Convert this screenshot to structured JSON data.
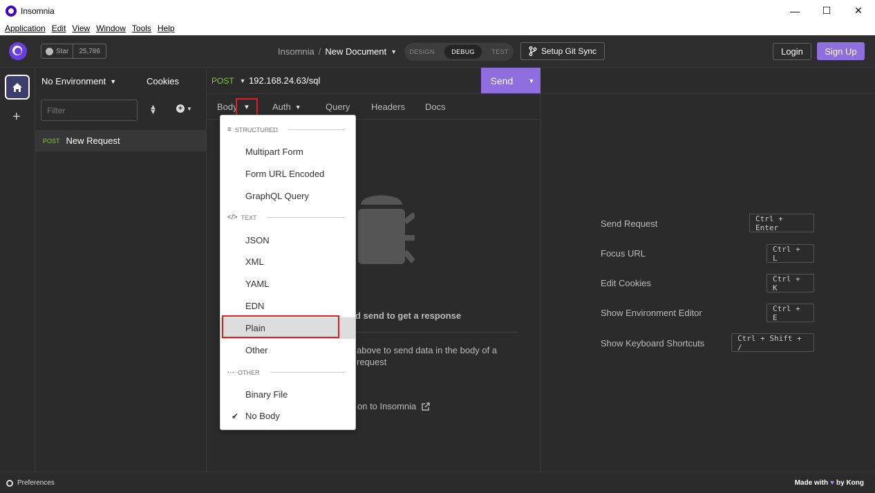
{
  "window": {
    "title": "Insomnia",
    "controls": {
      "minimize": "—",
      "maximize": "☐",
      "close": "✕"
    }
  },
  "menubar": [
    "Application",
    "Edit",
    "View",
    "Window",
    "Tools",
    "Help"
  ],
  "header": {
    "github_star_label": "Star",
    "github_star_count": "25,786",
    "breadcrumb_root": "Insomnia",
    "breadcrumb_sep": "/",
    "breadcrumb_doc": "New Document",
    "modes": [
      "DESIGN",
      "DEBUG",
      "TEST"
    ],
    "active_mode": "DEBUG",
    "git_sync_label": "Setup Git Sync",
    "login_label": "Login",
    "signup_label": "Sign Up"
  },
  "sidebar": {
    "environment": "No Environment",
    "cookies": "Cookies",
    "filter_placeholder": "Filter",
    "requests": [
      {
        "method": "POST",
        "name": "New Request"
      }
    ]
  },
  "request": {
    "method": "POST",
    "url": "192.168.24.63/sql",
    "send_label": "Send",
    "tabs": {
      "body": "Body",
      "auth": "Auth",
      "query": "Query",
      "headers": "Headers",
      "docs": "Docs"
    },
    "empty_state": {
      "line1": "d send to get a response",
      "line2": "above to send data in the body of a request",
      "line3": "on to Insomnia"
    }
  },
  "body_dropdown": {
    "sections": [
      {
        "label": "STRUCTURED",
        "icon": "≡"
      },
      {
        "label": "TEXT",
        "icon": "</>"
      },
      {
        "label": "OTHER",
        "icon": "···"
      }
    ],
    "items": {
      "multipart": "Multipart Form",
      "form_url": "Form URL Encoded",
      "graphql": "GraphQL Query",
      "json": "JSON",
      "xml": "XML",
      "yaml": "YAML",
      "edn": "EDN",
      "plain": "Plain",
      "other": "Other",
      "binary": "Binary File",
      "no_body": "No Body"
    },
    "selected": "No Body",
    "hovered": "Plain"
  },
  "shortcuts": [
    {
      "label": "Send Request",
      "keys": "Ctrl + Enter"
    },
    {
      "label": "Focus URL",
      "keys": "Ctrl + L"
    },
    {
      "label": "Edit Cookies",
      "keys": "Ctrl + K"
    },
    {
      "label": "Show Environment Editor",
      "keys": "Ctrl + E"
    },
    {
      "label": "Show Keyboard Shortcuts",
      "keys": "Ctrl + Shift + /"
    }
  ],
  "footer": {
    "preferences": "Preferences",
    "made_with": "Made with",
    "by": "by Kong"
  },
  "colors": {
    "accent": "#8f6fdf",
    "post_method": "#7ece3c",
    "highlight_box": "#e02020",
    "background": "#2b2b2b"
  }
}
